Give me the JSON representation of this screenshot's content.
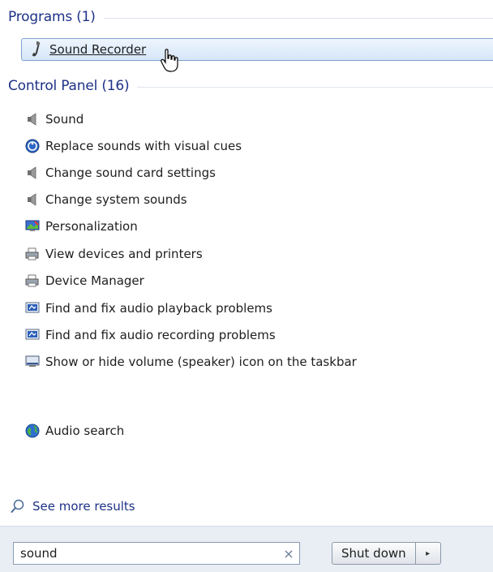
{
  "programs": {
    "title": "Programs (1)",
    "items": [
      {
        "label": "Sound Recorder",
        "icon": "microphone-icon"
      }
    ]
  },
  "control_panel": {
    "title": "Control Panel (16)",
    "items": [
      {
        "label": "Sound",
        "icon": "speaker-icon"
      },
      {
        "label": "Replace sounds with visual cues",
        "icon": "ease-of-access-icon"
      },
      {
        "label": "Change sound card settings",
        "icon": "speaker-icon"
      },
      {
        "label": "Change system sounds",
        "icon": "speaker-icon"
      },
      {
        "label": "Personalization",
        "icon": "personalization-icon"
      },
      {
        "label": "View devices and printers",
        "icon": "printer-icon"
      },
      {
        "label": "Device Manager",
        "icon": "printer-icon"
      },
      {
        "label": "Find and fix audio playback problems",
        "icon": "troubleshoot-icon"
      },
      {
        "label": "Find and fix audio recording problems",
        "icon": "troubleshoot-icon"
      },
      {
        "label": "Show or hide volume (speaker) icon on the taskbar",
        "icon": "taskbar-icon"
      }
    ]
  },
  "other": {
    "items": [
      {
        "label": "Audio search",
        "icon": "globe-icon"
      }
    ]
  },
  "see_more": {
    "label": "See more results",
    "icon": "search-icon"
  },
  "search": {
    "value": "sound",
    "clear_icon": "close-icon",
    "clear_glyph": "×"
  },
  "shutdown": {
    "label": "Shut down",
    "arrow_icon": "chevron-right-icon",
    "arrow_glyph": "▸"
  },
  "colors": {
    "header": "#1e3287",
    "link": "#1e3287",
    "selection_border": "#7da2ce"
  }
}
